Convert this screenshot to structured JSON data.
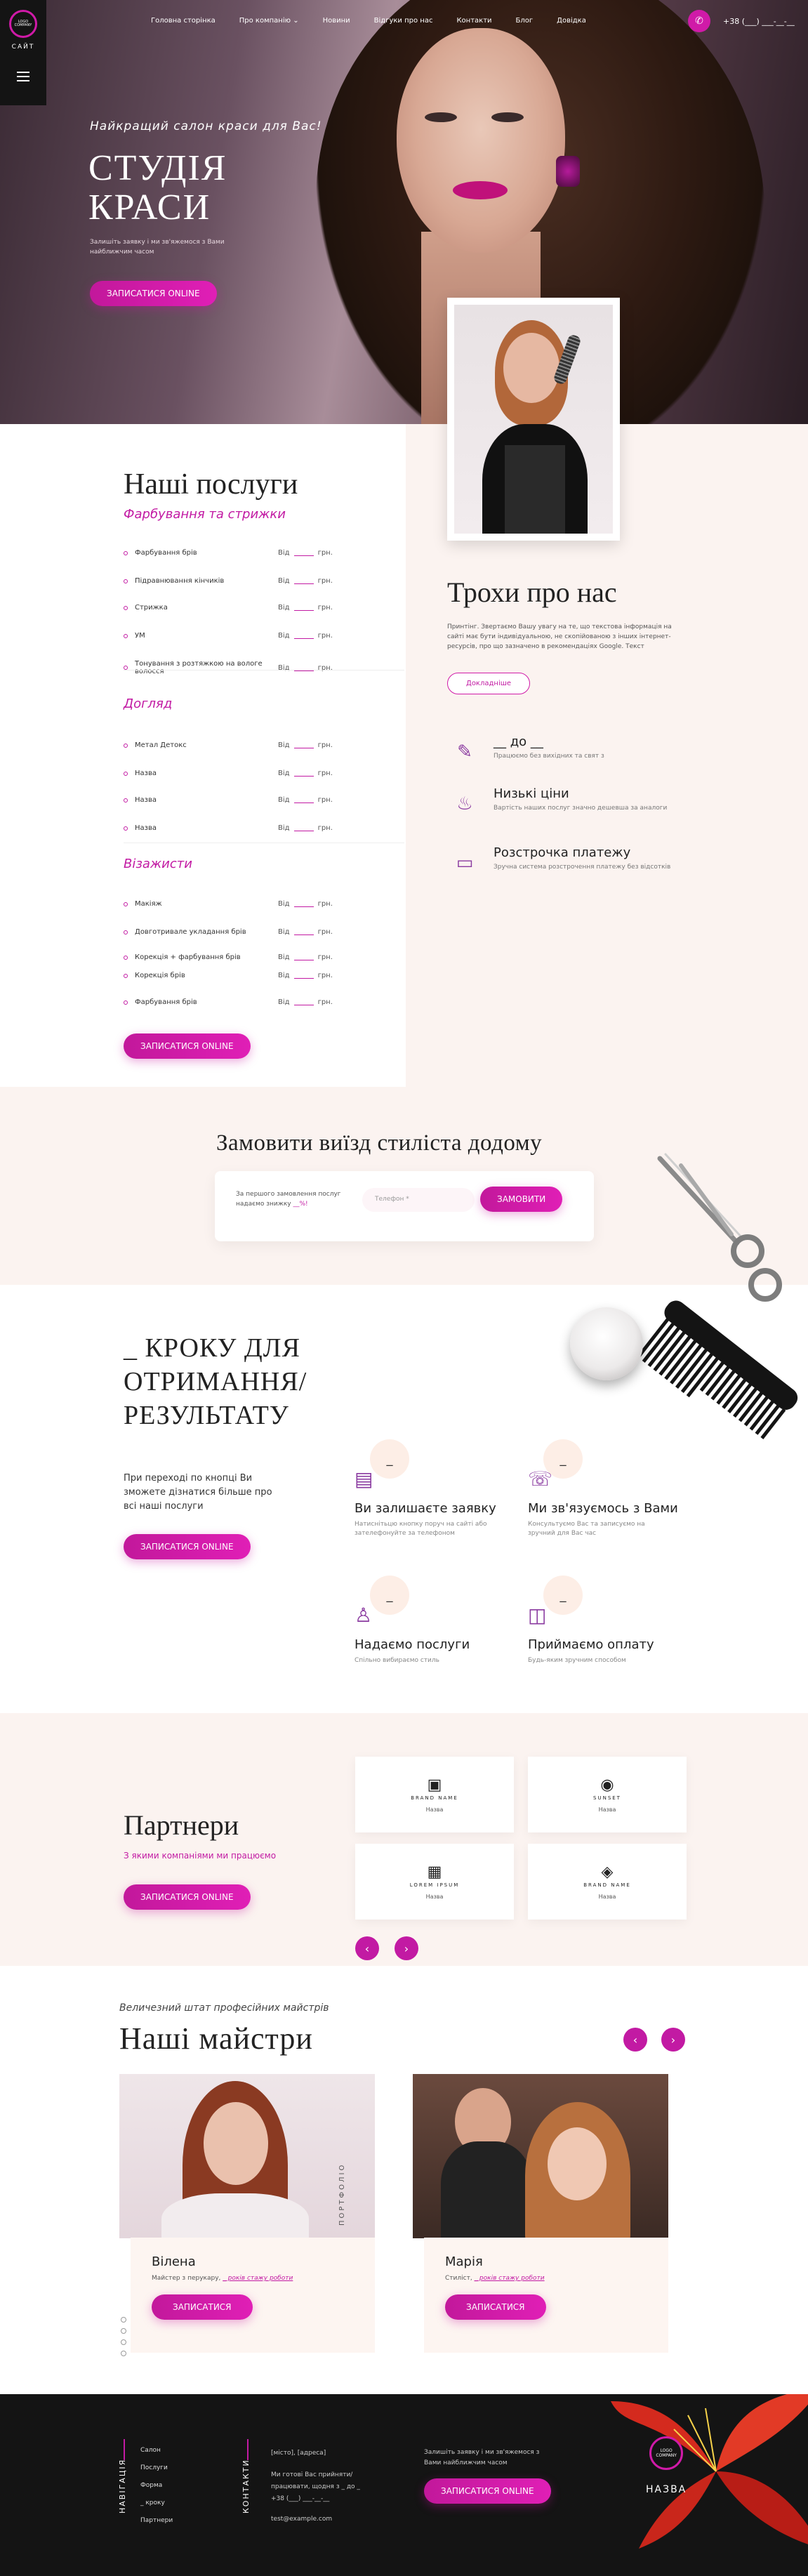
{
  "header": {
    "logo_ring_text": "LOGO COMPANY",
    "logo_name": "САЙТ",
    "nav": [
      "Головна сторінка",
      "Про компанію ⌄",
      "Новини",
      "Відгуки про нас",
      "Контакти",
      "Блог",
      "Довідка"
    ],
    "phone": "+38 (___) ___-__-__"
  },
  "hero": {
    "tagline": "Найкращий салон краси для Вас!",
    "title_line1": "СТУДІЯ",
    "title_line2": "КРАСИ",
    "subtitle": "Залишіть заявку і ми зв'яжемося з Вами найближчим часом",
    "cta": "ЗАПИСАТИСЯ ONLINE"
  },
  "services": {
    "title": "Наші послуги",
    "from": "Від",
    "currency": "грн.",
    "categories": [
      {
        "name": "Фарбування та стрижки",
        "items": [
          "Фарбування брів",
          "Підравнювання кінчиків",
          "Стрижка",
          "УМ",
          "Тонування з розтяжкою на вологе волосся"
        ]
      },
      {
        "name": "Догляд",
        "items": [
          "Метал Детокс",
          "Назва",
          "Назва",
          "Назва"
        ]
      },
      {
        "name": "Візажисти",
        "items": [
          "Макіяж",
          "Довготривале укладання брів",
          "Корекція + фарбування брів",
          "Корекція брів",
          "Фарбування брів"
        ]
      }
    ],
    "cta": "ЗАПИСАТИСЯ ONLINE"
  },
  "about": {
    "title": "Трохи про нас",
    "text": "Принтінг. Звертаємо Вашу увагу на те, що текстова інформація на сайті має бути індивідуальною, не скопійованою з інших інтернет-ресурсів, про що зазначено в рекомендаціях Google. Текст",
    "more": "Докладніше",
    "features": [
      {
        "icon": "hair-dryer-icon",
        "glyph": "✎",
        "title": "__ до __",
        "desc": "Працюємо без вихідних та свят з"
      },
      {
        "icon": "hand-money-icon",
        "glyph": "♨",
        "title": "Низькі ціни",
        "desc": "Вартість наших послуг значно дешевша за аналоги"
      },
      {
        "icon": "card-icon",
        "glyph": "▭",
        "title": "Розстрочка платежу",
        "desc": "Зручна система розстрочення платежу без відсотків"
      }
    ]
  },
  "order": {
    "title": "Замовити виїзд стиліста додому",
    "label": "За першого замовлення послуг надаємо знижку",
    "discount": "__%!",
    "placeholder": "Телефон *",
    "button": "ЗАМОВИТИ"
  },
  "steps": {
    "title": "_ КРОКУ ДЛЯ ОТРИМАННЯ/ РЕЗУЛЬТАТУ",
    "text": "При переході по кнопці Ви зможете дізнатися більше про всі наші послуги",
    "cta": "ЗАПИСАТИСЯ ONLINE",
    "items": [
      {
        "num": "_",
        "icon": "form-icon",
        "glyph": "▤",
        "title": "Ви залишаєте заявку",
        "desc": "Натиснітьцю кнопку поруч на сайті або зателефонуйте за телефоном"
      },
      {
        "num": "_",
        "icon": "phone-call-icon",
        "glyph": "☏",
        "title": "Ми зв'язуємось з Вами",
        "desc": "Консультуємо Вас та записуємо на зручний для Вас час"
      },
      {
        "num": "_",
        "icon": "team-icon",
        "glyph": "♙",
        "title": "Надаємо послуги",
        "desc": "Спільно вибираємо стиль"
      },
      {
        "num": "_",
        "icon": "payment-icon",
        "glyph": "◫",
        "title": "Приймаємо оплату",
        "desc": "Будь-яким зручним способом"
      }
    ]
  },
  "partners": {
    "title": "Партнери",
    "subtitle": "З якими компаніями ми працюємо",
    "cta": "ЗАПИСАТИСЯ ONLINE",
    "items": [
      {
        "logo": "▣",
        "name": "BRAND NAME",
        "caption": "Назва"
      },
      {
        "logo": "◉",
        "name": "SUNSET",
        "caption": "Назва"
      },
      {
        "logo": "▦",
        "name": "LOREM IPSUM",
        "caption": "Назва"
      },
      {
        "logo": "◈",
        "name": "BRAND NAME",
        "caption": "Назва"
      }
    ],
    "prev": "‹",
    "next": "›"
  },
  "masters": {
    "subtitle": "Величезний штат професійних майстрів",
    "title": "Наші майстри",
    "portfolio": "ПОРТФОЛІО",
    "items": [
      {
        "name": "Вілена",
        "role": "Майстер з перукару,",
        "exp": "_ років стажу роботи",
        "button": "ЗАПИСАТИСЯ"
      },
      {
        "name": "Марія",
        "role": "Стиліст,",
        "exp": "_ років стажу роботи",
        "button": "ЗАПИСАТИСЯ"
      }
    ]
  },
  "footer": {
    "nav_label": "НАВІГАЦІЯ",
    "contacts_label": "КОНТАКТИ",
    "links": [
      "Салон",
      "Послуги",
      "Форма",
      "_ кроку",
      "Партнери"
    ],
    "address": "[місто], [адреса]",
    "hours": "Ми готові Вас прийняти/працювати, щодня з _ до _",
    "phone": "+38 (___) ___-__-__",
    "email": "test@example.com",
    "info": "Залишіть заявку і ми зв'яжемося з Вами найближчим часом",
    "cta": "ЗАПИСАТИСЯ ONLINE",
    "logo_ring_text": "LOGO COMPANY",
    "logo_name": "НАЗВА"
  },
  "colors": {
    "accent": "#c21aa3",
    "soft": "#fbf3f0",
    "dark": "#141414"
  }
}
